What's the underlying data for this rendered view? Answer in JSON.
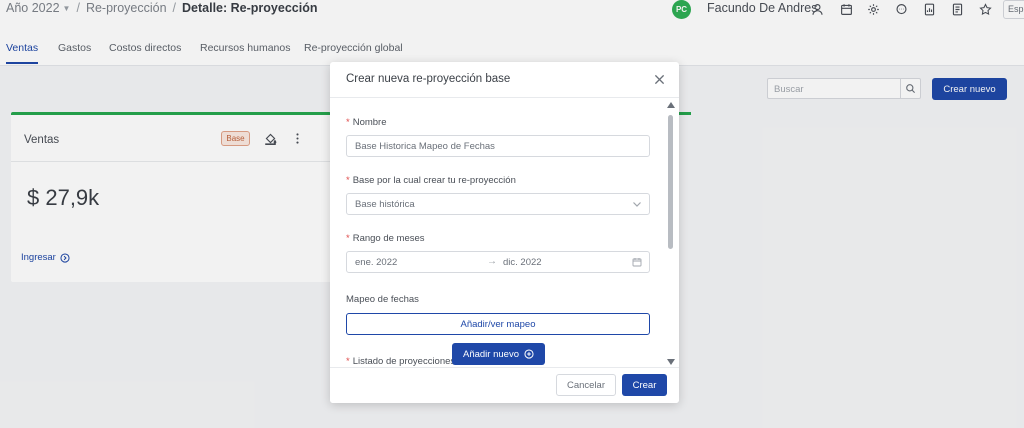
{
  "header": {
    "breadcrumb": [
      "Año 2022",
      "Re-proyección",
      "Detalle: Re-proyección"
    ],
    "avatar_initials": "PC",
    "username": "Facundo De Andres",
    "lang_label": "Esp",
    "icons": [
      "user-icon",
      "calendar-icon",
      "gear-icon",
      "chat-icon",
      "report-icon",
      "document-icon",
      "star-icon"
    ]
  },
  "tabs": [
    "Ventas",
    "Gastos",
    "Costos directos",
    "Recursos humanos",
    "Re-proyección global"
  ],
  "toolbar": {
    "search_placeholder": "Buscar",
    "create_label": "Crear nuevo"
  },
  "card": {
    "title": "Ventas",
    "badge": "Base",
    "value": "$ 27,9k",
    "link": "Ingresar"
  },
  "modal": {
    "title": "Crear nueva re-proyección base",
    "fields": {
      "name": {
        "label": "Nombre",
        "value": "Base Historica Mapeo de Fechas"
      },
      "base": {
        "label": "Base por la cual crear tu re-proyección",
        "value": "Base histórica"
      },
      "range": {
        "label": "Rango de meses",
        "start": "ene. 2022",
        "separator": "→",
        "end": "dic. 2022"
      },
      "mapping": {
        "label": "Mapeo de fechas",
        "button": "Añadir/ver mapeo"
      },
      "list": {
        "label": "Listado de proyecciones",
        "add_button": "Añadir nuevo"
      }
    },
    "required_mark": "*",
    "cancel_label": "Cancelar",
    "ok_label": "Crear"
  },
  "colors": {
    "primary": "#1f48a8",
    "success": "#26a74f",
    "danger": "#e04c4c"
  }
}
